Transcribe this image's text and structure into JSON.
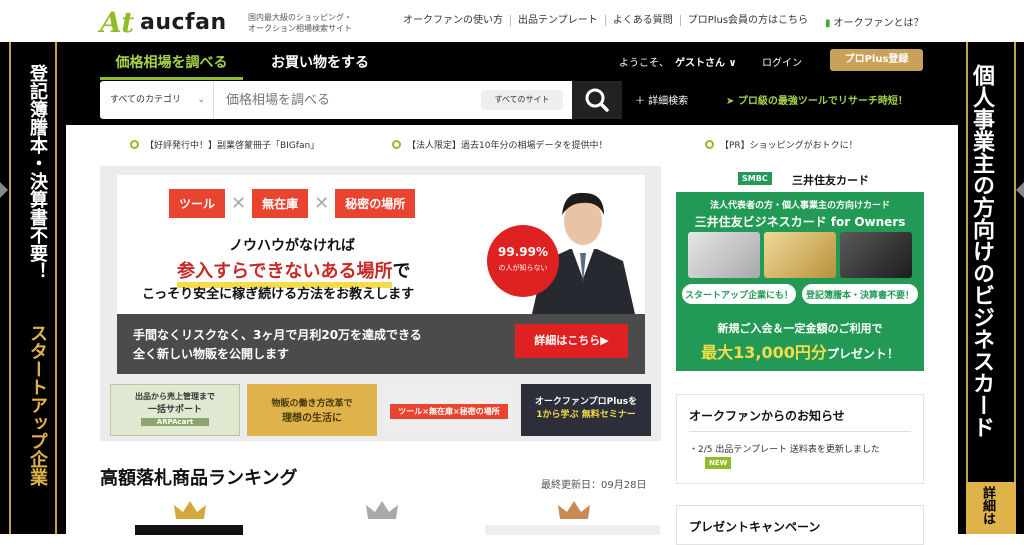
{
  "header": {
    "logo_mark": "At",
    "logo_text": "aucfan",
    "tagline_line1": "国内最大級のショッピング・",
    "tagline_line2": "オークション相場検索サイト",
    "links": [
      "オークファンの使い方",
      "出品テンプレート",
      "よくある質問",
      "プロPlus会員の方はこちら"
    ],
    "about": "オークファンとは？"
  },
  "nav": {
    "tab_price": "価格相場を調べる",
    "tab_shopping": "お買い物をする",
    "greeting": "ようこそ、",
    "guest": "ゲストさん ∨",
    "login": "ログイン",
    "pro_register": "プロPlus登録"
  },
  "search": {
    "category": "すべてのカテゴリ",
    "placeholder": "価格相場を調べる",
    "site": "すべてのサイト",
    "advanced": "＋ 詳細検索",
    "promo": "➤ プロ級の最強ツールでリサーチ時短！"
  },
  "side_left": {
    "line1": "登記簿謄本・決算書不要！",
    "line2": "スタートアップ企業"
  },
  "side_right": {
    "line1": "個人事業主の方向けのビジネスカード",
    "line2": "詳細は"
  },
  "notices": [
    "【好評発行中！】副業啓蒙冊子「BIGfan」",
    "【法人限定】過去10年分の相場データを提供中！",
    "【PR】ショッピングがおトクに！"
  ],
  "hero": {
    "tags": [
      "ツール",
      "無在庫",
      "秘密の場所"
    ],
    "line1": "ノウハウがなければ",
    "line2a": "参入すらできないある場所",
    "line2b": "で",
    "line3": "こっそり安全に稼ぎ続ける方法をお教えします",
    "band1": "手間なくリスクなく、3ヶ月で月利20万を達成できる",
    "band2": "全く新しい物販を公開します",
    "detail_button": "詳細はこちら▶",
    "badge_pct": "99.99%",
    "badge_sub": "の人が知らない"
  },
  "minis": [
    {
      "line1": "出品から売上管理まで",
      "line2": "一括サポート",
      "line3": "ARPAcart"
    },
    {
      "line1": "物販の働き方改革で",
      "line2": "理想の生活に"
    },
    {
      "line1": "ツール×無在庫×秘密の場所"
    },
    {
      "line1": "オークファンプロPlusを",
      "line2": "1から学ぶ 無料セミナー"
    }
  ],
  "right_ad": {
    "smbc": "SMBC",
    "brand": "三井住友カード",
    "sub1": "法人代表者の方・個人事業主の方向けカード",
    "sub2": "三井住友ビジネスカード for Owners",
    "pill1": "スタートアップ企業にも！",
    "pill2": "登記簿謄本・決算書不要！",
    "sub3": "新規ご入会＆一定金額のご利用で",
    "sub4a": "最大13,000円分",
    "sub4b": "プレゼント！"
  },
  "news": {
    "title": "オークファンからのお知らせ",
    "item": "・2/5 出品テンプレート 送料表を更新しました",
    "badge": "NEW"
  },
  "present": {
    "title": "プレゼントキャンペーン"
  },
  "ranking": {
    "title": "高額落札商品ランキング",
    "updated": "最終更新日：09月28日"
  },
  "colors": {
    "accent_green": "#8fbd2a",
    "gold": "#c9a25a",
    "hero_red": "#e02121",
    "card_green": "#229a56"
  }
}
